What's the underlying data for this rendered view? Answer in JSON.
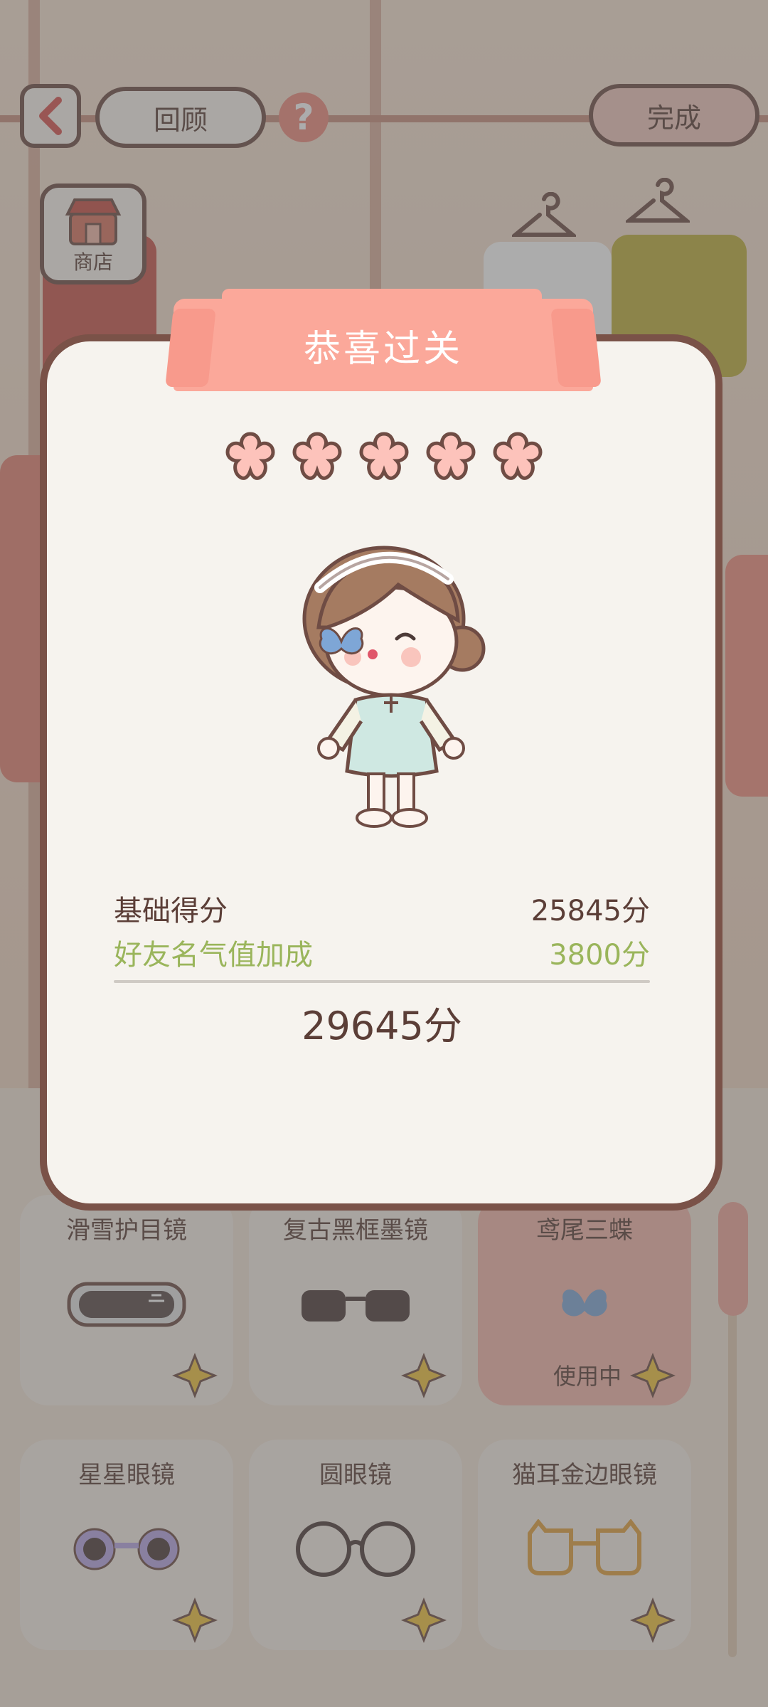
{
  "top_bar": {
    "back_icon": "chevron-left-icon",
    "review_label": "回顾",
    "help_glyph": "?",
    "done_label": "完成",
    "shop_label": "商店",
    "shop_icon": "shop-icon"
  },
  "dialog": {
    "title": "恭喜过关",
    "stars_earned": 5,
    "stars_total": 5,
    "base_score_label": "基础得分",
    "base_score_value": "25845分",
    "bonus_label": "好友名气值加成",
    "bonus_value": "3800分",
    "total_value": "29645分"
  },
  "items": [
    {
      "name": "滑雪护目镜",
      "icon": "ski-goggles-icon",
      "active": false
    },
    {
      "name": "复古黑框墨镜",
      "icon": "black-sunglasses-icon",
      "active": false
    },
    {
      "name": "鸢尾三蝶",
      "icon": "butterfly-clip-icon",
      "active": true,
      "status": "使用中"
    },
    {
      "name": "星星眼镜",
      "icon": "flower-glasses-icon",
      "active": false
    },
    {
      "name": "圆眼镜",
      "icon": "round-glasses-icon",
      "active": false
    },
    {
      "name": "猫耳金边眼镜",
      "icon": "cat-ear-glasses-icon",
      "active": false
    }
  ],
  "colors": {
    "accent": "#fba89a",
    "bonus_green": "#9ab55b",
    "outline_brown": "#7a5248",
    "star_pink": "#fdc3bb"
  }
}
